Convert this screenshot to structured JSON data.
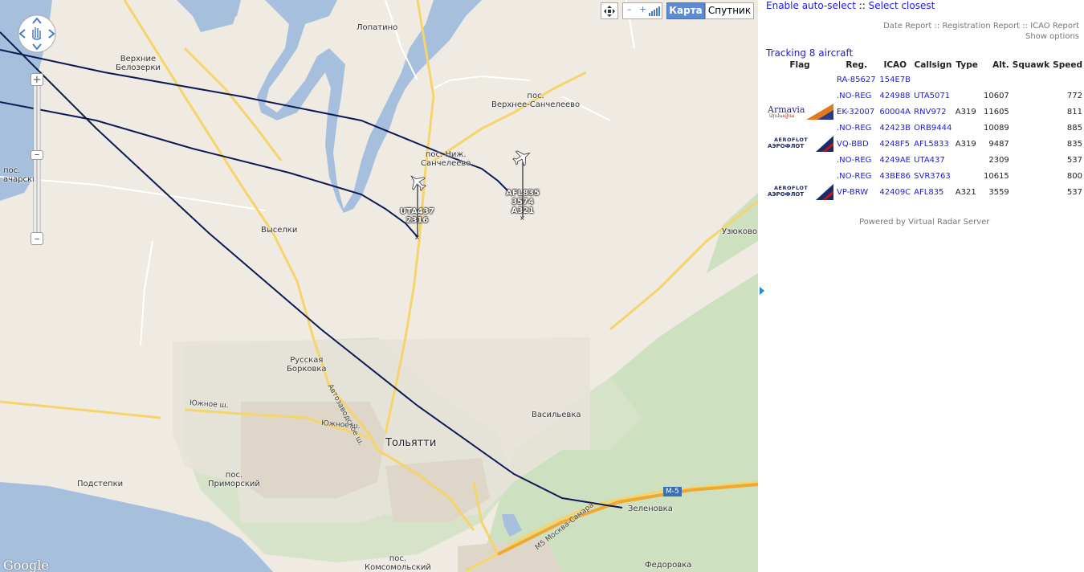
{
  "map": {
    "places": {
      "lopatino": "Лопатино",
      "verkhnie_belozerki_1": "Верхние",
      "verkhnie_belozerki_2": "Белозерки",
      "verkh_sanch_1": "пос.",
      "verkh_sanch_2": "Верхнее-Санчелеево",
      "nizh_sanch_1": "пос. Ниж.",
      "nizh_sanch_2": "Санчелеево",
      "pos_left_1": "пос.",
      "pos_left_2": "ачарски",
      "vyselki": "Выселки",
      "uzyukovo": "Узюково",
      "russkaya_1": "Русская",
      "russkaya_2": "Борковка",
      "vasilevka": "Васильевка",
      "tolyatti": "Тольятти",
      "zelenovka": "Зеленовка",
      "podstepki": "Подстепки",
      "primorsky_1": "пос.",
      "primorsky_2": "Приморский",
      "komsomolsky_1": "пос.",
      "komsomolsky_2": "Комсомольский",
      "fedorovka": "Федоровка"
    },
    "roads": {
      "yuzhnoe_1": "Южное ш.",
      "yuzhnoe_2": "Южное ш.",
      "avtozavodskoe": "Автозаводское ш.",
      "m5": "М5 Москва-Самара",
      "m5_shield": "М-5"
    },
    "aircraft": [
      {
        "line1": "UTA437",
        "line2": "2316",
        "line3": ""
      },
      {
        "line1": "AFL835",
        "line2": "3574",
        "line3": "A321"
      }
    ],
    "maptype_map": "Карта",
    "maptype_satellite": "Спутник",
    "google": "Google"
  },
  "panel": {
    "auto_select": "Enable auto-select",
    "sep1": " :: ",
    "select_closest": "Select closest",
    "date_report": "Date Report",
    "sep2": " :: ",
    "registration_report": "Registration Report",
    "sep3": " :: ",
    "icao_report": "ICAO Report",
    "show_options": "Show options",
    "tracking": "Tracking 8 aircraft",
    "headers": [
      "Flag",
      "Reg.",
      "ICAO",
      "Callsign",
      "Type",
      "Alt.",
      "Squawk",
      "Speed"
    ],
    "rows": [
      {
        "flag": "",
        "reg": "RA-85627",
        "icao": "154E7B",
        "callsign": "",
        "type": "",
        "alt": "",
        "squawk": "",
        "speed": ""
      },
      {
        "flag": "",
        "reg": ".NO-REG",
        "icao": "424988",
        "callsign": "UTA5071",
        "type": "",
        "alt": "10607",
        "squawk": "",
        "speed": "772"
      },
      {
        "flag": "Armavia",
        "flag_sub": "Արմավիա",
        "reg": "EK-32007",
        "icao": "60004A",
        "callsign": "RNV972",
        "type": "A319",
        "alt": "11605",
        "squawk": "",
        "speed": "811"
      },
      {
        "flag": "",
        "reg": ".NO-REG",
        "icao": "42423B",
        "callsign": "ORB9444",
        "type": "",
        "alt": "10089",
        "squawk": "",
        "speed": "885"
      },
      {
        "flag": "AEROFLOT",
        "flag_sub": "АЭРОФЛОТ",
        "reg": "VQ-BBD",
        "icao": "4248F5",
        "callsign": "AFL5833",
        "type": "A319",
        "alt": "9487",
        "squawk": "",
        "speed": "835"
      },
      {
        "flag": "",
        "reg": ".NO-REG",
        "icao": "4249AE",
        "callsign": "UTA437",
        "type": "",
        "alt": "2309",
        "squawk": "",
        "speed": "537"
      },
      {
        "flag": "",
        "reg": ".NO-REG",
        "icao": "43BE86",
        "callsign": "SVR3763",
        "type": "",
        "alt": "10615",
        "squawk": "",
        "speed": "800"
      },
      {
        "flag": "AEROFLOT",
        "flag_sub": "АЭРОФЛОТ",
        "reg": "VP-BRW",
        "icao": "42409C",
        "callsign": "AFL835",
        "type": "A321",
        "alt": "3559",
        "squawk": "",
        "speed": "537"
      }
    ],
    "powered": "Powered by Virtual Radar Server"
  },
  "colors": {
    "track": "#0e1a55",
    "water": "#a5bfdd",
    "land": "#efebe3",
    "forest": "#cde0c0",
    "road_major": "#f9d56a",
    "link": "#1a1ae6"
  }
}
